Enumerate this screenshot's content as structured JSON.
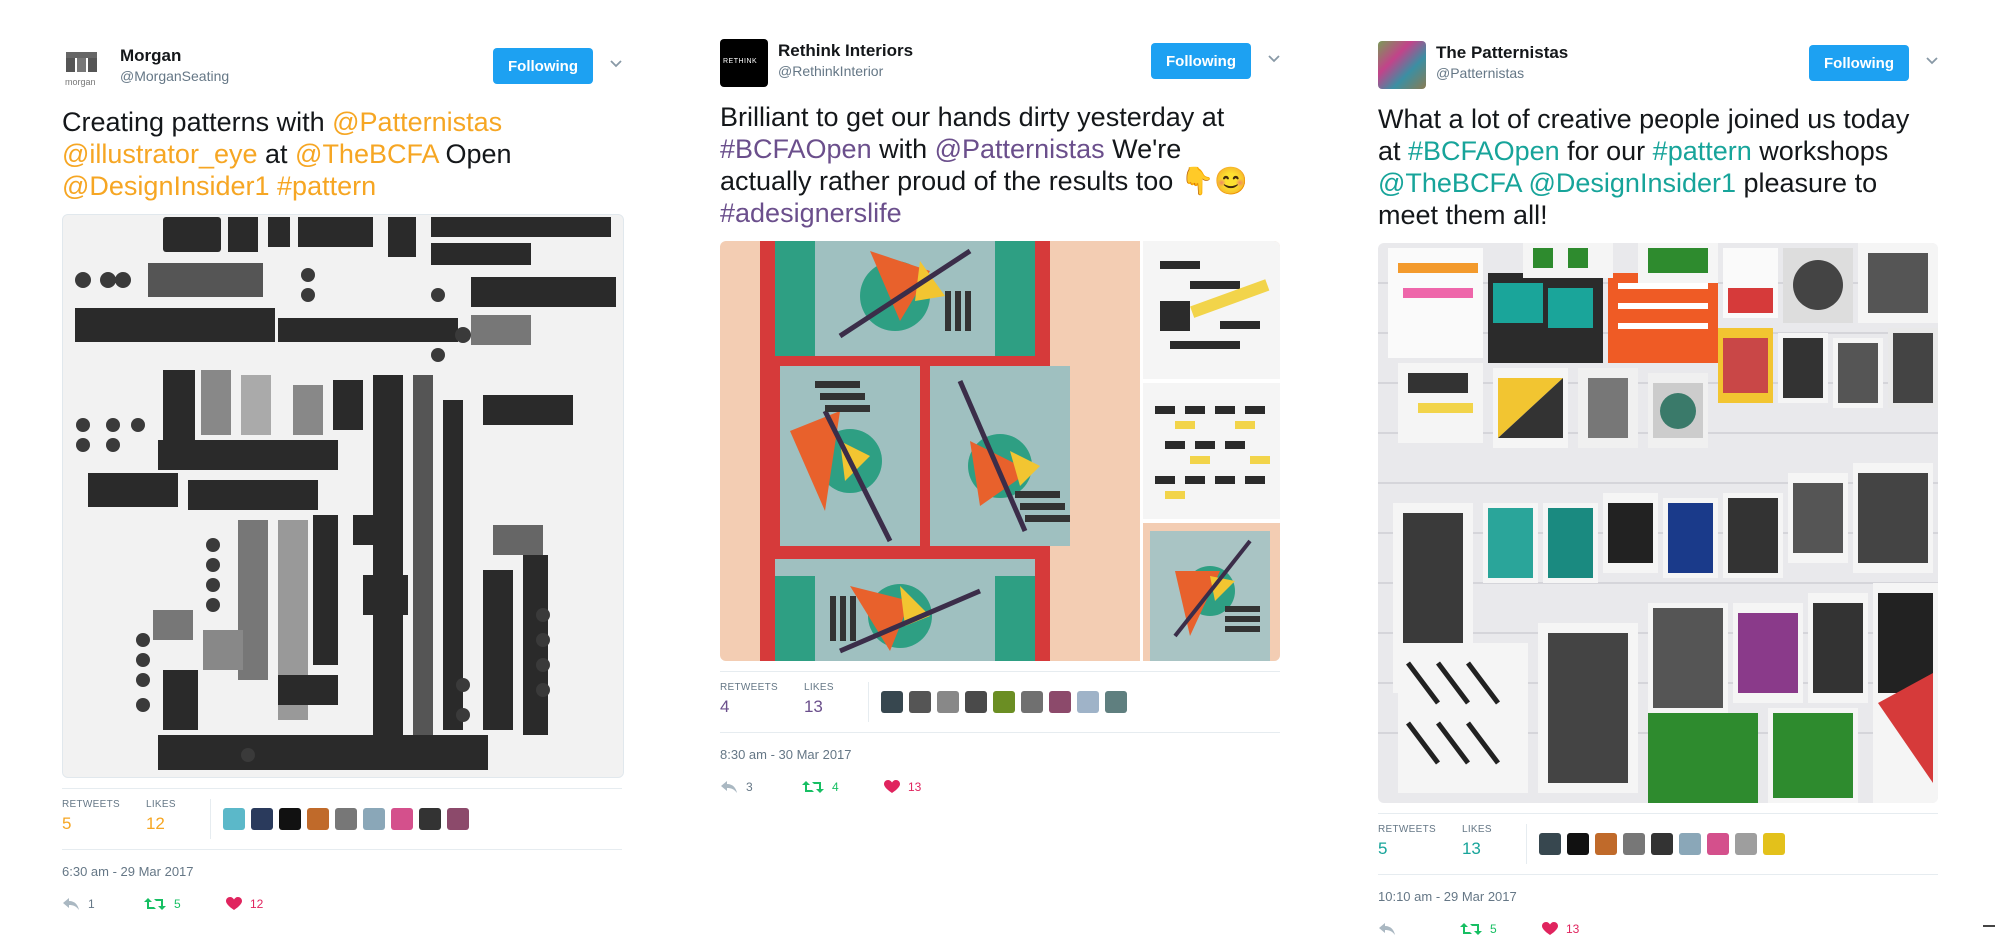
{
  "tweets": [
    {
      "name": "Morgan",
      "handle": "@MorganSeating",
      "follow_label": "Following",
      "avatar_text": "morgan",
      "text_segments": [
        {
          "t": "Creating patterns with ",
          "link": false
        },
        {
          "t": "@Patternistas",
          "link": true
        },
        {
          "t": " ",
          "link": false
        },
        {
          "t": "@illustrator_eye",
          "link": true
        },
        {
          "t": " at ",
          "link": false
        },
        {
          "t": "@TheBCFA",
          "link": true
        },
        {
          "t": " Open ",
          "link": false
        },
        {
          "t": "@DesignInsider1",
          "link": true
        },
        {
          "t": " ",
          "link": false
        },
        {
          "t": "#pattern",
          "link": true
        }
      ],
      "retweets_label": "RETWEETS",
      "retweets": "5",
      "likes_label": "LIKES",
      "likes": "12",
      "timestamp": "6:30 am - 29 Mar 2017",
      "reply_count": "1",
      "retweet_count": "5",
      "like_count": "12",
      "accent": "#f6a623",
      "likers": [
        "#5bb8c9",
        "#2a3a5c",
        "#111111",
        "#c06a2a",
        "#777777",
        "#8aa7b8",
        "#d4508c",
        "#333333",
        "#8c4a6b"
      ]
    },
    {
      "name": "Rethink Interiors",
      "handle": "@RethinkInterior",
      "follow_label": "Following",
      "avatar_text": "RETHINK",
      "text_segments": [
        {
          "t": "Brilliant to get our hands dirty yesterday at ",
          "link": false
        },
        {
          "t": "#BCFAOpen",
          "link": true
        },
        {
          "t": " with ",
          "link": false
        },
        {
          "t": "@Patternistas",
          "link": true
        },
        {
          "t": " We're actually rather proud of the results too 👇😊 ",
          "link": false
        },
        {
          "t": "#adesignerslife",
          "link": true
        }
      ],
      "retweets_label": "RETWEETS",
      "retweets": "4",
      "likes_label": "LIKES",
      "likes": "13",
      "timestamp": "8:30 am - 30 Mar 2017",
      "reply_count": "3",
      "retweet_count": "4",
      "like_count": "13",
      "accent": "#6b4f8c",
      "likers": [
        "#37474f",
        "#555555",
        "#888888",
        "#4a4a4a",
        "#6b8e23",
        "#707070",
        "#8c4a6b",
        "#9fb3c8",
        "#5f7f7f"
      ]
    },
    {
      "name": "The Patternistas",
      "handle": "@Patternistas",
      "follow_label": "Following",
      "avatar_text": "",
      "text_segments": [
        {
          "t": "What a lot of creative people joined us today at ",
          "link": false
        },
        {
          "t": "#BCFAOpen",
          "link": true
        },
        {
          "t": " for our ",
          "link": false
        },
        {
          "t": "#pattern",
          "link": true
        },
        {
          "t": " workshops ",
          "link": false
        },
        {
          "t": "@TheBCFA",
          "link": true
        },
        {
          "t": " ",
          "link": false
        },
        {
          "t": "@DesignInsider1",
          "link": true
        },
        {
          "t": " pleasure to meet them all!",
          "link": false
        }
      ],
      "retweets_label": "RETWEETS",
      "retweets": "5",
      "likes_label": "LIKES",
      "likes": "13",
      "timestamp": "10:10 am - 29 Mar 2017",
      "reply_count": "",
      "retweet_count": "5",
      "like_count": "13",
      "accent": "#17a49a",
      "likers": [
        "#37474f",
        "#111111",
        "#c06a2a",
        "#777777",
        "#333333",
        "#8aa7b8",
        "#d4508c",
        "#9e9e9e",
        "#e3c11b"
      ]
    }
  ]
}
